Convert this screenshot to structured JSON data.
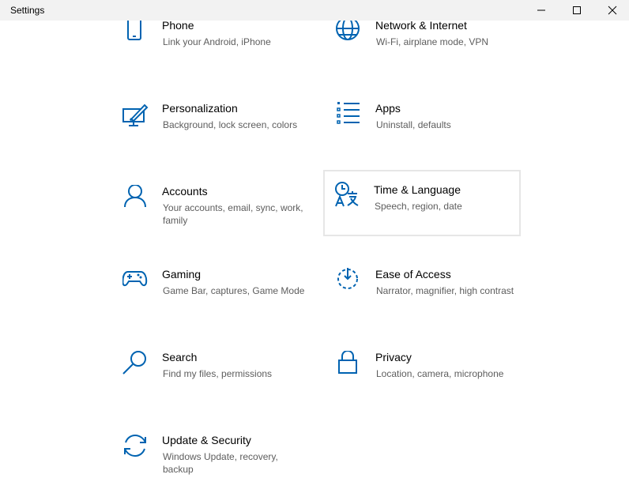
{
  "window": {
    "title": "Settings"
  },
  "settings": {
    "phone": {
      "name": "Phone",
      "desc": "Link your Android, iPhone"
    },
    "network": {
      "name": "Network & Internet",
      "desc": "Wi-Fi, airplane mode, VPN"
    },
    "personalization": {
      "name": "Personalization",
      "desc": "Background, lock screen, colors"
    },
    "apps": {
      "name": "Apps",
      "desc": "Uninstall, defaults"
    },
    "accounts": {
      "name": "Accounts",
      "desc": "Your accounts, email, sync, work, family"
    },
    "time_language": {
      "name": "Time & Language",
      "desc": "Speech, region, date"
    },
    "gaming": {
      "name": "Gaming",
      "desc": "Game Bar, captures, Game Mode"
    },
    "ease_of_access": {
      "name": "Ease of Access",
      "desc": "Narrator, magnifier, high contrast"
    },
    "search": {
      "name": "Search",
      "desc": "Find my files, permissions"
    },
    "privacy": {
      "name": "Privacy",
      "desc": "Location, camera, microphone"
    },
    "update_security": {
      "name": "Update & Security",
      "desc": "Windows Update, recovery, backup"
    }
  },
  "colors": {
    "accent": "#0063b1",
    "titlebar": "#f2f2f2",
    "description": "#5d5d5d"
  },
  "icons": {
    "phone": "phone-icon",
    "network": "globe-icon",
    "personalization": "paint-icon",
    "apps": "apps-list-icon",
    "accounts": "person-icon",
    "time_language": "time-language-icon",
    "gaming": "gamepad-icon",
    "ease_of_access": "ease-of-access-icon",
    "search": "search-icon",
    "privacy": "lock-icon",
    "update_security": "sync-icon"
  }
}
